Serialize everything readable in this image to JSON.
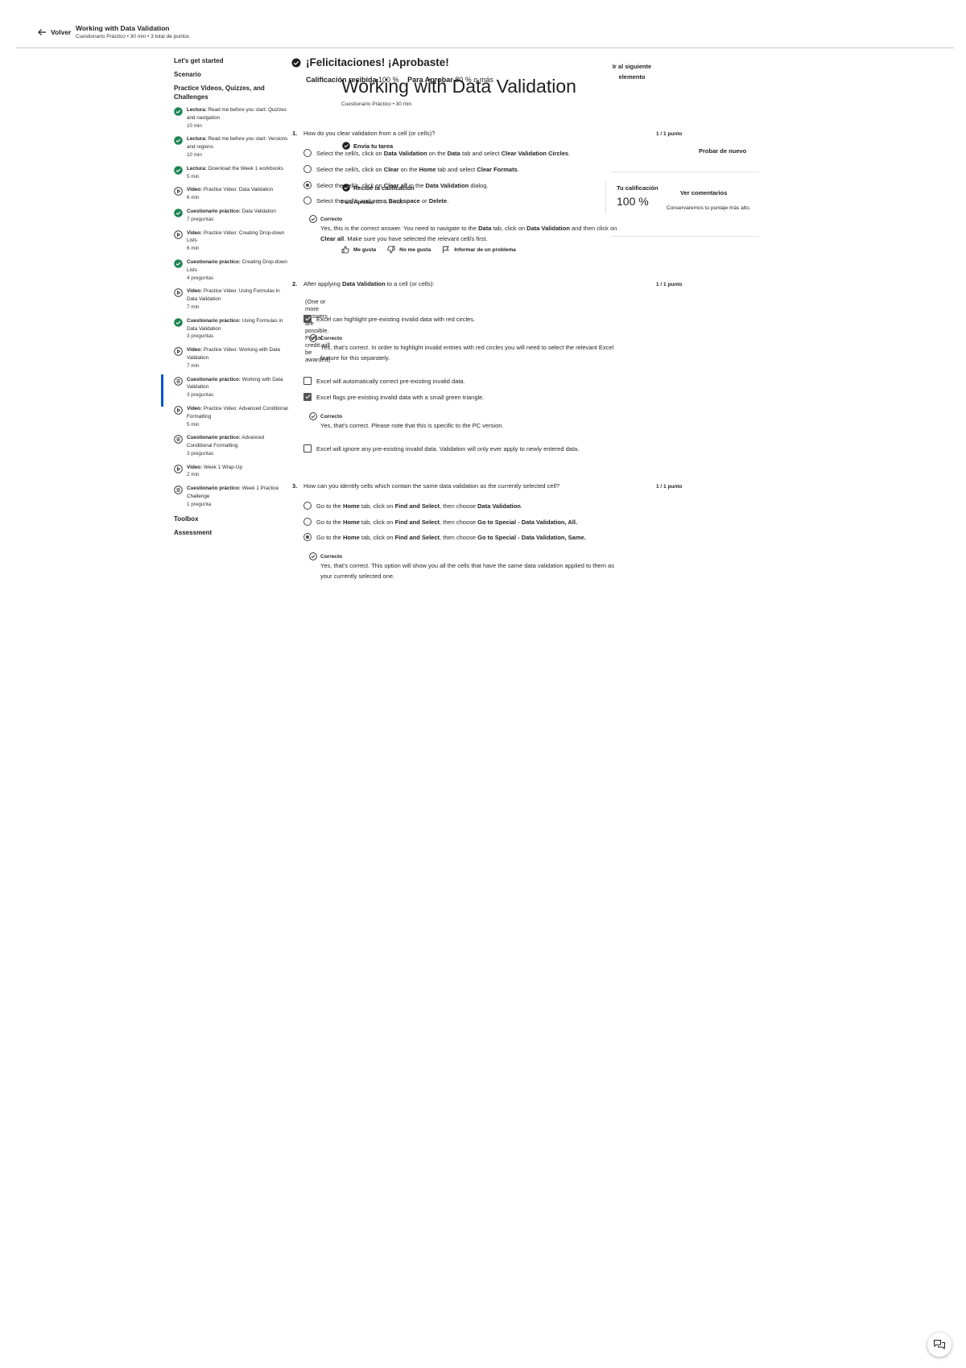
{
  "header": {
    "back_label": "Volver",
    "title": "Working with Data Validation",
    "subtitle": "Cuestionario Práctico • 30 min • 3 total de puntos"
  },
  "sidebar": {
    "sections": [
      "Let's get started",
      "Scenario",
      "Practice Videos, Quizzes, and Challenges",
      "Toolbox",
      "Assessment"
    ],
    "items": [
      {
        "type": "Lectura:",
        "name": "Read me before you start: Quizzes and navigation",
        "meta": "10 min",
        "icon": "completed-check-icon"
      },
      {
        "type": "Lectura:",
        "name": "Read me before you start: Versions and regions",
        "meta": "10 min",
        "icon": "completed-check-icon"
      },
      {
        "type": "Lectura:",
        "name": "Download the Week 1 workbooks",
        "meta": "5 min",
        "icon": "completed-check-icon"
      },
      {
        "type": "Video:",
        "name": "Practice Video: Data Validation",
        "meta": "6 min",
        "icon": "play-icon"
      },
      {
        "type": "Cuestionario práctico:",
        "name": "Data Validation",
        "meta": "7 preguntas",
        "icon": "completed-check-icon"
      },
      {
        "type": "Video:",
        "name": "Practice Video: Creating Drop-down Lists",
        "meta": "6 min",
        "icon": "play-icon"
      },
      {
        "type": "Cuestionario práctico:",
        "name": "Creating Drop-down Lists",
        "meta": "4 preguntas",
        "icon": "completed-check-icon"
      },
      {
        "type": "Video:",
        "name": "Practice Video: Using Formulas in Data Validation",
        "meta": "7 min",
        "icon": "play-icon"
      },
      {
        "type": "Cuestionario práctico:",
        "name": "Using Formulas in Data Validation",
        "meta": "3 preguntas",
        "icon": "completed-check-icon"
      },
      {
        "type": "Video:",
        "name": "Practice Video: Working with Data Validation",
        "meta": "7 min",
        "icon": "play-icon"
      },
      {
        "type": "Cuestionario práctico:",
        "name": "Working with Data Validation",
        "meta": "3 preguntas",
        "icon": "quiz-icon",
        "active": true
      },
      {
        "type": "Video:",
        "name": "Practice Video: Advanced Conditional Formatting",
        "meta": "5 min",
        "icon": "play-icon"
      },
      {
        "type": "Cuestionario práctico:",
        "name": "Advanced Conditional Formatting",
        "meta": "3 preguntas",
        "icon": "quiz-icon"
      },
      {
        "type": "Video:",
        "name": "Week 1 Wrap-Up",
        "meta": "2 min",
        "icon": "play-icon"
      },
      {
        "type": "Cuestionario práctico:",
        "name": "Week 1 Practice Challenge",
        "meta": "1 pregunta",
        "icon": "quiz-icon"
      }
    ]
  },
  "banner": {
    "title": "¡Felicitaciones! ¡Aprobaste!",
    "grade_label": "Calificación recibida",
    "grade_value": "100 %",
    "pass_label": "Para Aprobar",
    "pass_value": "80 % o más",
    "next_label_1": "Ir al siguiente",
    "next_label_2": "elemento"
  },
  "page": {
    "title": "Working with Data Validation",
    "subtitle": "Cuestionario Práctico • 30 min"
  },
  "steps": {
    "submit_label": "Envía tu tarea",
    "receive_label": "Recibe la calificación",
    "pass_label": "Para Aprobar",
    "pass_value": "80 % o más"
  },
  "grade_panel": {
    "retry_label": "Probar de nuevo",
    "your_grade_label": "Tu calificación",
    "your_grade_value": "100 %",
    "feedback_label": "Ver comentarios",
    "keep_note": "Conservaremos tu puntaje más alto."
  },
  "actions": {
    "like": "Me gusta",
    "dislike": "No me gusta",
    "report": "Informar de un problema"
  },
  "questions": [
    {
      "num": "1.",
      "text": "How do you clear validation from a cell (or cells)?",
      "points": "1 / 1 punto",
      "options": [
        "Select the cell/s, click on Data Validation on the Data tab and select Clear Validation Circles.",
        "Select the cell/s, click on Clear on the Home tab and select Clear Formats.",
        "Select the cell/s, click on Clear all in the Data Validation dialog.",
        "Select the cell/s and press Backspace or Delete."
      ],
      "selected": 2,
      "feedback_label": "Correcto",
      "feedback": "Yes, this is the correct answer. You need to navigate to the Data tab, click on Data Validation and then click on Clear all. Make sure you have selected the relevant cell/s first."
    },
    {
      "num": "2.",
      "text": "After applying Data Validation to a cell (or cells):",
      "note": "(One or more answers are possible. Partial credit will be awarded)",
      "points": "1 / 1 punto",
      "options": [
        "Excel can highlight pre-existing invalid data with red circles.",
        "Excel will automatically correct pre-existing invalid data.",
        "Excel flags pre-existing invalid data with a small green triangle.",
        "Excel will ignore any pre-existing invalid data. Validation will only ever apply to newly entered data."
      ],
      "checked": [
        true,
        false,
        true,
        false
      ],
      "feedback_label": "Correcto",
      "feedback_1": "Yes, that's correct. In order to highlight invalid entries with red circles you will need to select the relevant Excel feature for this separately.",
      "feedback_2": "Yes, that's correct. Please note that this is specific to the PC version."
    },
    {
      "num": "3.",
      "text": "How can you identify cells which contain the same data validation as the currently selected cell?",
      "points": "1 / 1 punto",
      "options": [
        "Go to the Home tab, click on Find and Select, then choose Data Validation.",
        "Go to the Home tab, click on Find and Select, then choose Go to Special - Data Validation, All.",
        "Go to the Home tab, click on Find and Select, then choose Go to Special - Data Validation, Same."
      ],
      "selected": 2,
      "feedback_label": "Correcto",
      "feedback": "Yes, that's correct. This option will show you all the cells that have the same data validation applied to them as your currently selected one."
    }
  ],
  "chat": {
    "icon": "chat-bubbles-icon"
  }
}
